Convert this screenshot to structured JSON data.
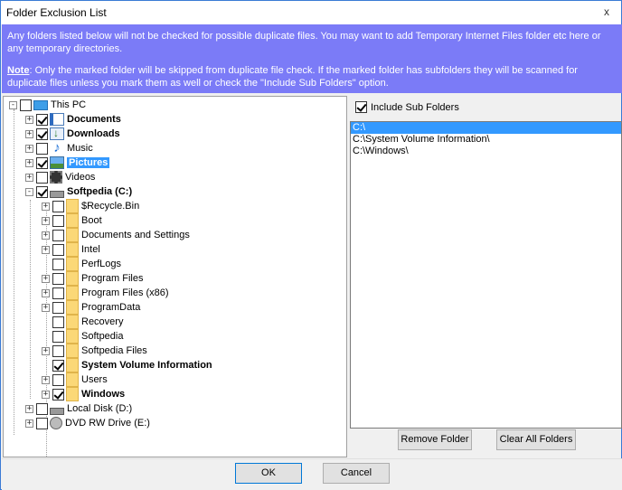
{
  "window": {
    "title": "Folder Exclusion List",
    "close_glyph": "x"
  },
  "info": {
    "line1": "Any folders listed below will not be checked for possible duplicate files. You may want to add Temporary Internet Files folder etc here or any temporary directories.",
    "note_label": "Note",
    "note_text": ":  Only the marked folder will be skipped from duplicate file check.  If the marked folder has subfolders they will be scanned for duplicate files unless you mark them as well or check the \"Include Sub Folders\" option."
  },
  "tree": [
    {
      "label": "This PC",
      "level": 0,
      "icon": "pc-icon",
      "checked": false,
      "bold": false,
      "expander": "-"
    },
    {
      "label": "Documents",
      "level": 1,
      "icon": "documents-icon",
      "checked": true,
      "bold": true,
      "expander": "+"
    },
    {
      "label": "Downloads",
      "level": 1,
      "icon": "downloads-icon",
      "checked": true,
      "bold": true,
      "expander": "+"
    },
    {
      "label": "Music",
      "level": 1,
      "icon": "music-icon",
      "checked": false,
      "bold": false,
      "expander": "+"
    },
    {
      "label": "Pictures",
      "level": 1,
      "icon": "pictures-icon",
      "checked": true,
      "bold": true,
      "selected": true,
      "expander": "+"
    },
    {
      "label": "Videos",
      "level": 1,
      "icon": "videos-icon",
      "checked": false,
      "bold": false,
      "expander": "+"
    },
    {
      "label": "Softpedia (C:)",
      "level": 1,
      "icon": "drive-icon",
      "checked": true,
      "bold": true,
      "expander": "-"
    },
    {
      "label": "$Recycle.Bin",
      "level": 2,
      "icon": "folder-icon",
      "checked": false,
      "bold": false,
      "expander": "+"
    },
    {
      "label": "Boot",
      "level": 2,
      "icon": "folder-icon",
      "checked": false,
      "bold": false,
      "expander": "+"
    },
    {
      "label": "Documents and Settings",
      "level": 2,
      "icon": "folder-icon",
      "checked": false,
      "bold": false,
      "expander": "+"
    },
    {
      "label": "Intel",
      "level": 2,
      "icon": "folder-icon",
      "checked": false,
      "bold": false,
      "expander": "+"
    },
    {
      "label": "PerfLogs",
      "level": 2,
      "icon": "folder-icon",
      "checked": false,
      "bold": false,
      "expander": ""
    },
    {
      "label": "Program Files",
      "level": 2,
      "icon": "folder-icon",
      "checked": false,
      "bold": false,
      "expander": "+"
    },
    {
      "label": "Program Files (x86)",
      "level": 2,
      "icon": "folder-icon",
      "checked": false,
      "bold": false,
      "expander": "+"
    },
    {
      "label": "ProgramData",
      "level": 2,
      "icon": "folder-icon",
      "checked": false,
      "bold": false,
      "expander": "+"
    },
    {
      "label": "Recovery",
      "level": 2,
      "icon": "folder-icon",
      "checked": false,
      "bold": false,
      "expander": ""
    },
    {
      "label": "Softpedia",
      "level": 2,
      "icon": "folder-icon",
      "checked": false,
      "bold": false,
      "expander": ""
    },
    {
      "label": "Softpedia Files",
      "level": 2,
      "icon": "folder-icon",
      "checked": false,
      "bold": false,
      "expander": "+"
    },
    {
      "label": "System Volume Information",
      "level": 2,
      "icon": "folder-icon",
      "checked": true,
      "bold": true,
      "expander": ""
    },
    {
      "label": "Users",
      "level": 2,
      "icon": "folder-icon",
      "checked": false,
      "bold": false,
      "expander": "+"
    },
    {
      "label": "Windows",
      "level": 2,
      "icon": "folder-icon",
      "checked": true,
      "bold": true,
      "expander": "+"
    },
    {
      "label": "Local Disk (D:)",
      "level": 1,
      "icon": "drive-icon",
      "checked": false,
      "bold": false,
      "expander": "+"
    },
    {
      "label": "DVD RW Drive (E:)",
      "level": 1,
      "icon": "dvd-icon",
      "checked": false,
      "bold": false,
      "expander": "+"
    }
  ],
  "include_sub": {
    "label": "Include Sub Folders",
    "checked": true
  },
  "excluded": [
    {
      "path": "C:\\",
      "selected": true
    },
    {
      "path": "C:\\System Volume Information\\",
      "selected": false
    },
    {
      "path": "C:\\Windows\\",
      "selected": false
    }
  ],
  "buttons": {
    "remove": "Remove Folder",
    "clear": "Clear All Folders",
    "ok": "OK",
    "cancel": "Cancel"
  }
}
